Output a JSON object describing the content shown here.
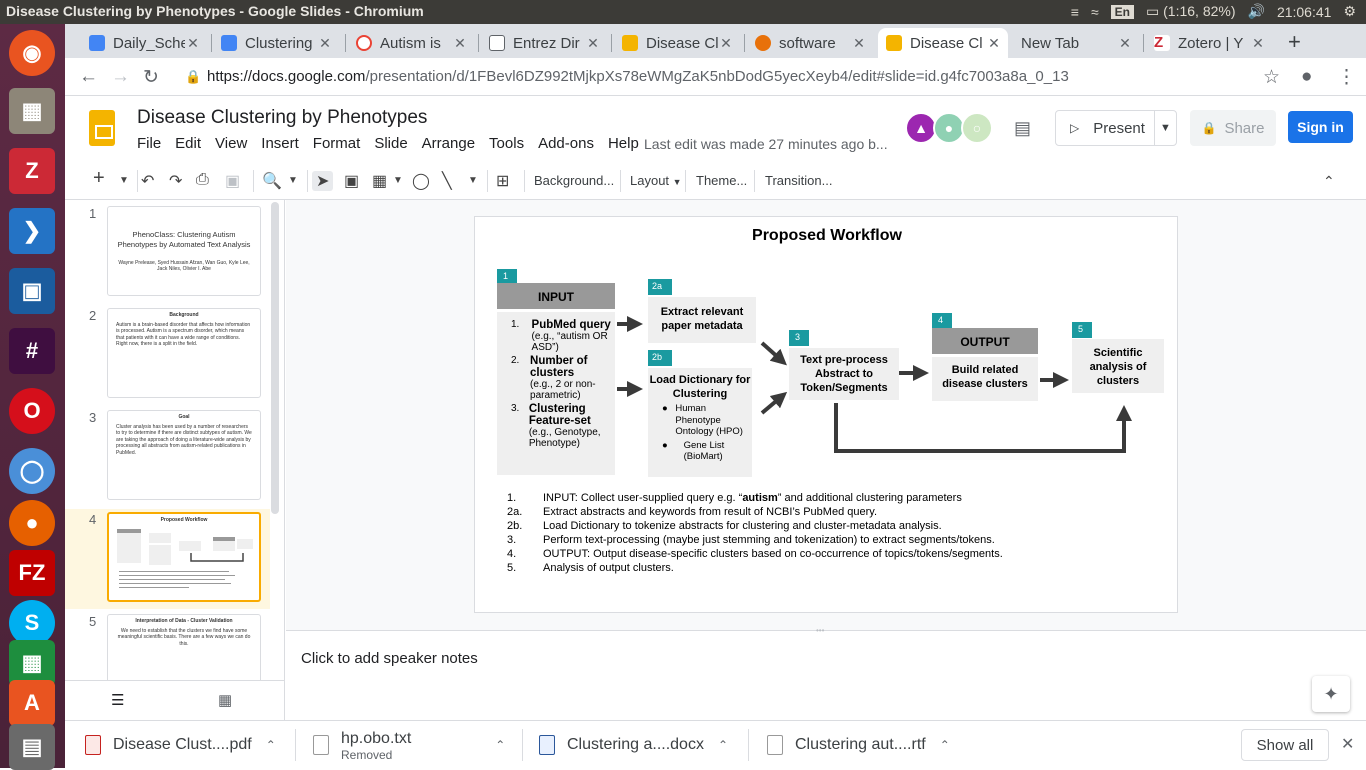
{
  "os": {
    "window_title": "Disease Clustering by Phenotypes - Google Slides - Chromium",
    "lang": "En",
    "battery": "(1:16, 82%)",
    "time": "21:06:41"
  },
  "tabs": [
    {
      "label": "Daily_Sche",
      "color": "#4285f4"
    },
    {
      "label": "Clustering",
      "color": "#4285f4"
    },
    {
      "label": "Autism is",
      "color": "#ea4335"
    },
    {
      "label": "Entrez Dir",
      "color": "#5f6368"
    },
    {
      "label": "Disease Cl",
      "color": "#f4b400"
    },
    {
      "label": "software",
      "color": "#e8710a"
    },
    {
      "label": "Disease Cl",
      "color": "#f4b400"
    },
    {
      "label": "New Tab",
      "color": "#ffffff"
    },
    {
      "label": "Zotero | Y",
      "color": "#cc2936"
    }
  ],
  "address": {
    "host": "https://docs.google.com",
    "path": "/presentation/d/1FBevl6DZ992tMjkpXs78eWMgZaK5nbDodG5yecXeyb4/edit#slide=id.g4fc7003a8a_0_13"
  },
  "app": {
    "doc_title": "Disease Clustering by Phenotypes",
    "menus": [
      "File",
      "Edit",
      "View",
      "Insert",
      "Format",
      "Slide",
      "Arrange",
      "Tools",
      "Add-ons",
      "Help"
    ],
    "last_edit": "Last edit was made 27 minutes ago b...",
    "present": "Present",
    "share": "Share",
    "signin": "Sign in"
  },
  "toolbar": {
    "background": "Background...",
    "layout": "Layout",
    "theme": "Theme...",
    "transition": "Transition..."
  },
  "filmstrip": [
    {
      "num": "1",
      "title": "PhenoClass: Clustering Autism Phenotypes by Automated Text Analysis",
      "body": "Wayne Prelease, Syed Hussain Afzan, Wan Guo, Kyle Lee, Jack Niles, Olivier I. Abe"
    },
    {
      "num": "2",
      "title": "Background",
      "body": "Autism is a brain-based disorder that affects how information is processed. Autism is a spectrum disorder, which means that patients with it can have a wide range of conditions. Right now, there is a split in the field."
    },
    {
      "num": "3",
      "title": "Goal",
      "body": "Cluster analysis has been used by a number of researchers to try to determine if there are distinct subtypes of autism. We are taking the approach of doing a literature-wide analysis by processing all abstracts from autism-related publications in PubMed."
    },
    {
      "num": "4",
      "title": "Proposed Workflow",
      "body": ""
    },
    {
      "num": "5",
      "title": "Interpretation of Data - Cluster Validation",
      "body": "We need to establish that the clusters we find have some meaningful scientific basis. There are a few ways we can do this."
    }
  ],
  "slide": {
    "title": "Proposed Workflow",
    "input": {
      "badge": "1",
      "header": "INPUT",
      "items": [
        {
          "num": "1.",
          "bold": "PubMed query",
          "detail": "(e.g., “autism OR ASD”)"
        },
        {
          "num": "2.",
          "bold": "Number of clusters",
          "detail": "(e.g., 2 or non-parametric)"
        },
        {
          "num": "3.",
          "bold": "Clustering Feature-set",
          "detail": "(e.g., Genotype, Phenotype)"
        }
      ]
    },
    "extract": {
      "badge": "2a",
      "label": "Extract relevant paper metadata"
    },
    "dictionary": {
      "badge": "2b",
      "label": "Load Dictionary for Clustering",
      "bullets": [
        "Human Phenotype Ontology (HPO)",
        "Gene List (BioMart)"
      ]
    },
    "preprocess": {
      "badge": "3",
      "label": "Text pre-process Abstract to Token/Segments"
    },
    "output": {
      "badge": "4",
      "header": "OUTPUT",
      "label": "Build related disease clusters"
    },
    "analysis": {
      "badge": "5",
      "label": "Scientific analysis of clusters"
    },
    "steps": [
      {
        "n": "1.",
        "pre": "INPUT: Collect user-supplied query e.g. “",
        "bold": "autism",
        "post": "” and additional clustering parameters"
      },
      {
        "n": "2a.",
        "pre": "Extract abstracts and keywords from result of NCBI’s PubMed query.",
        "bold": "",
        "post": ""
      },
      {
        "n": "2b.",
        "pre": "Load Dictionary to tokenize abstracts for clustering and cluster-metadata analysis.",
        "bold": "",
        "post": ""
      },
      {
        "n": "3.",
        "pre": "Perform text-processing (maybe just stemming and tokenization) to extract segments/tokens.",
        "bold": "",
        "post": ""
      },
      {
        "n": "4.",
        "pre": "OUTPUT: Output disease-specific clusters based on co-occurrence of topics/tokens/segments.",
        "bold": "",
        "post": ""
      },
      {
        "n": "5.",
        "pre": "Analysis of output clusters.",
        "bold": "",
        "post": ""
      }
    ]
  },
  "notes": {
    "placeholder": "Click to add speaker notes"
  },
  "downloads": [
    {
      "name": "Disease Clust....pdf",
      "status": ""
    },
    {
      "name": "hp.obo.txt",
      "status": "Removed"
    },
    {
      "name": "Clustering a....docx",
      "status": ""
    },
    {
      "name": "Clustering aut....rtf",
      "status": ""
    }
  ],
  "shelf": {
    "show_all": "Show all"
  }
}
